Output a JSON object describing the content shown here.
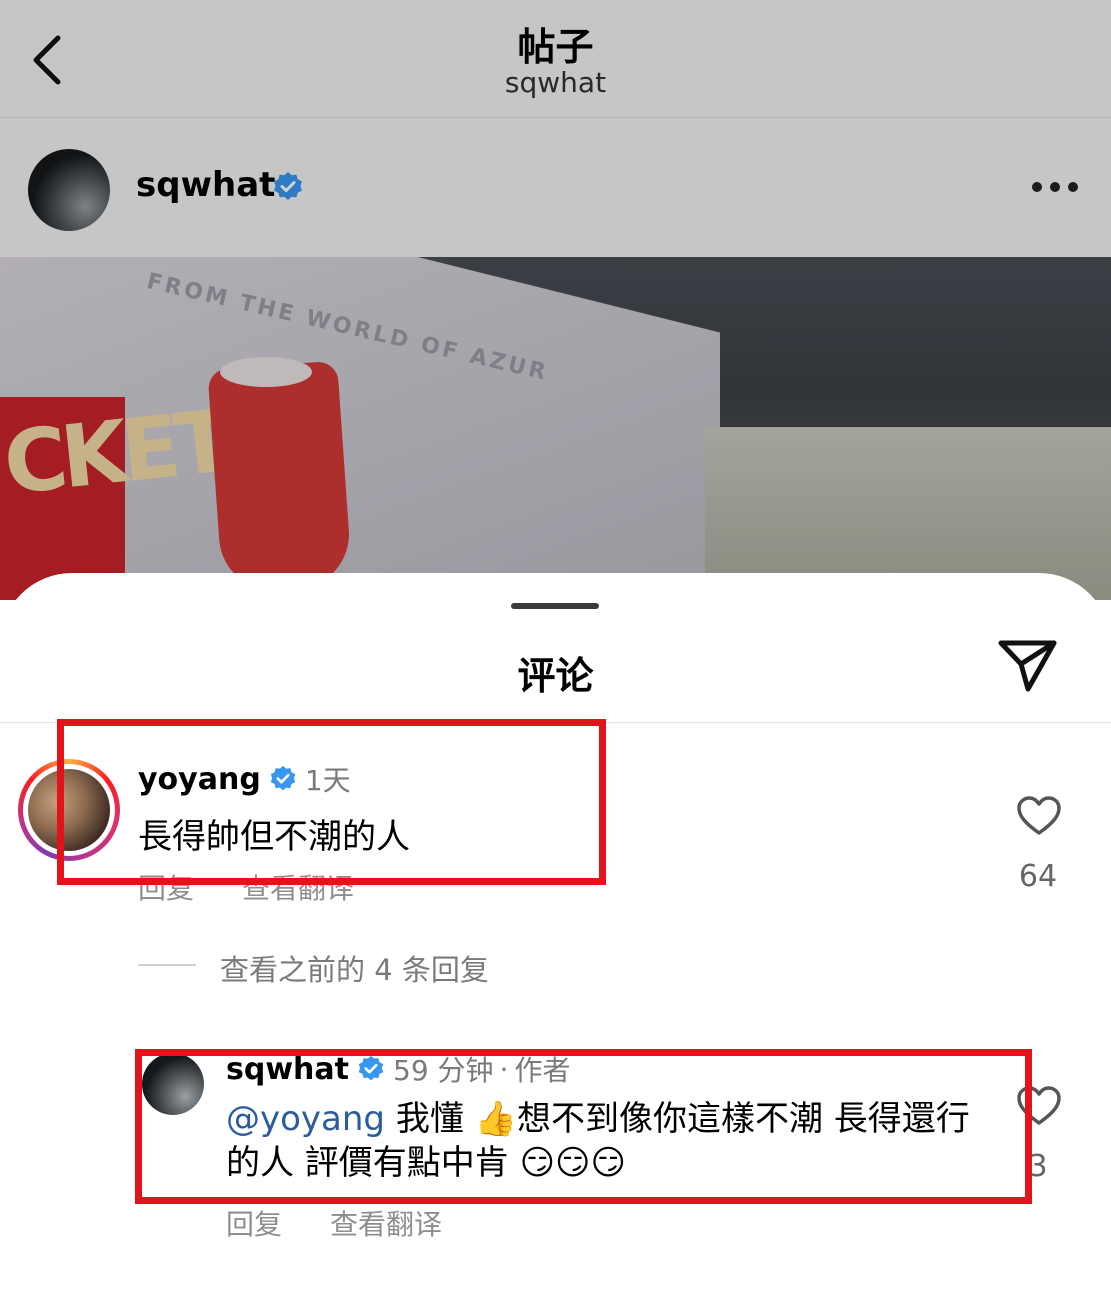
{
  "header": {
    "title": "帖子",
    "subtitle": "sqwhat"
  },
  "post": {
    "username": "sqwhat",
    "verified": true
  },
  "image": {
    "mural_text": "FROM THE WORLD OF AZUR",
    "mural_big_text": "CKET"
  },
  "sheet": {
    "title": "评论"
  },
  "comments": [
    {
      "username": "yoyang",
      "verified": true,
      "time": "1天",
      "text": "長得帥但不潮的人",
      "reply_label": "回复",
      "translate_label": "查看翻译",
      "likes": "64"
    },
    {
      "username": "sqwhat",
      "verified": true,
      "time": "59 分钟",
      "separator": "·",
      "author_badge": "作者",
      "mention": "@yoyang",
      "text": " 我懂 👍想不到像你這樣不潮 長得還行的人 評價有點中肯 😏😏😏",
      "reply_label": "回复",
      "translate_label": "查看翻译",
      "likes": "3"
    }
  ],
  "view_previous_replies": "查看之前的 4 条回复",
  "colors": {
    "annotation": "#e2141a",
    "verified": "#3797f0",
    "mention": "#2b5d9c"
  }
}
